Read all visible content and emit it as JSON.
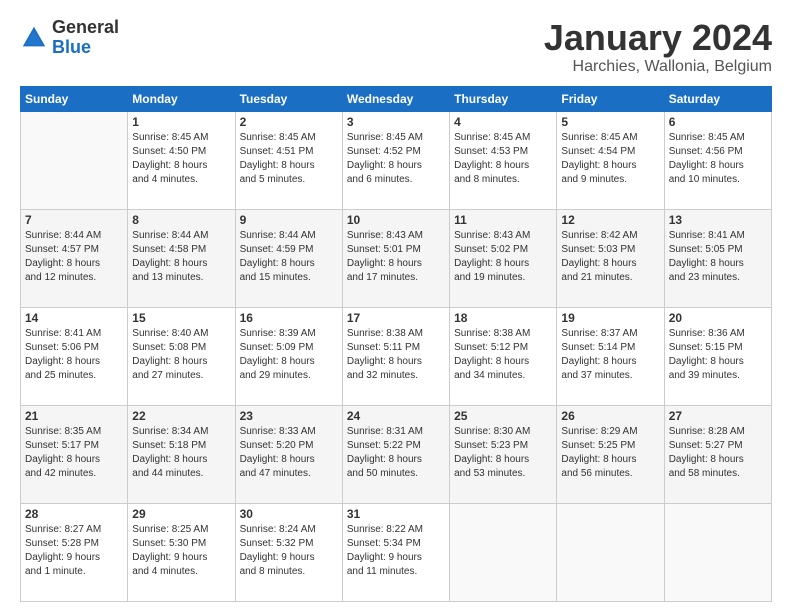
{
  "logo": {
    "general": "General",
    "blue": "Blue"
  },
  "title": "January 2024",
  "subtitle": "Harchies, Wallonia, Belgium",
  "weekdays": [
    "Sunday",
    "Monday",
    "Tuesday",
    "Wednesday",
    "Thursday",
    "Friday",
    "Saturday"
  ],
  "rows": [
    [
      {
        "day": "",
        "info": ""
      },
      {
        "day": "1",
        "info": "Sunrise: 8:45 AM\nSunset: 4:50 PM\nDaylight: 8 hours\nand 4 minutes."
      },
      {
        "day": "2",
        "info": "Sunrise: 8:45 AM\nSunset: 4:51 PM\nDaylight: 8 hours\nand 5 minutes."
      },
      {
        "day": "3",
        "info": "Sunrise: 8:45 AM\nSunset: 4:52 PM\nDaylight: 8 hours\nand 6 minutes."
      },
      {
        "day": "4",
        "info": "Sunrise: 8:45 AM\nSunset: 4:53 PM\nDaylight: 8 hours\nand 8 minutes."
      },
      {
        "day": "5",
        "info": "Sunrise: 8:45 AM\nSunset: 4:54 PM\nDaylight: 8 hours\nand 9 minutes."
      },
      {
        "day": "6",
        "info": "Sunrise: 8:45 AM\nSunset: 4:56 PM\nDaylight: 8 hours\nand 10 minutes."
      }
    ],
    [
      {
        "day": "7",
        "info": "Sunrise: 8:44 AM\nSunset: 4:57 PM\nDaylight: 8 hours\nand 12 minutes."
      },
      {
        "day": "8",
        "info": "Sunrise: 8:44 AM\nSunset: 4:58 PM\nDaylight: 8 hours\nand 13 minutes."
      },
      {
        "day": "9",
        "info": "Sunrise: 8:44 AM\nSunset: 4:59 PM\nDaylight: 8 hours\nand 15 minutes."
      },
      {
        "day": "10",
        "info": "Sunrise: 8:43 AM\nSunset: 5:01 PM\nDaylight: 8 hours\nand 17 minutes."
      },
      {
        "day": "11",
        "info": "Sunrise: 8:43 AM\nSunset: 5:02 PM\nDaylight: 8 hours\nand 19 minutes."
      },
      {
        "day": "12",
        "info": "Sunrise: 8:42 AM\nSunset: 5:03 PM\nDaylight: 8 hours\nand 21 minutes."
      },
      {
        "day": "13",
        "info": "Sunrise: 8:41 AM\nSunset: 5:05 PM\nDaylight: 8 hours\nand 23 minutes."
      }
    ],
    [
      {
        "day": "14",
        "info": "Sunrise: 8:41 AM\nSunset: 5:06 PM\nDaylight: 8 hours\nand 25 minutes."
      },
      {
        "day": "15",
        "info": "Sunrise: 8:40 AM\nSunset: 5:08 PM\nDaylight: 8 hours\nand 27 minutes."
      },
      {
        "day": "16",
        "info": "Sunrise: 8:39 AM\nSunset: 5:09 PM\nDaylight: 8 hours\nand 29 minutes."
      },
      {
        "day": "17",
        "info": "Sunrise: 8:38 AM\nSunset: 5:11 PM\nDaylight: 8 hours\nand 32 minutes."
      },
      {
        "day": "18",
        "info": "Sunrise: 8:38 AM\nSunset: 5:12 PM\nDaylight: 8 hours\nand 34 minutes."
      },
      {
        "day": "19",
        "info": "Sunrise: 8:37 AM\nSunset: 5:14 PM\nDaylight: 8 hours\nand 37 minutes."
      },
      {
        "day": "20",
        "info": "Sunrise: 8:36 AM\nSunset: 5:15 PM\nDaylight: 8 hours\nand 39 minutes."
      }
    ],
    [
      {
        "day": "21",
        "info": "Sunrise: 8:35 AM\nSunset: 5:17 PM\nDaylight: 8 hours\nand 42 minutes."
      },
      {
        "day": "22",
        "info": "Sunrise: 8:34 AM\nSunset: 5:18 PM\nDaylight: 8 hours\nand 44 minutes."
      },
      {
        "day": "23",
        "info": "Sunrise: 8:33 AM\nSunset: 5:20 PM\nDaylight: 8 hours\nand 47 minutes."
      },
      {
        "day": "24",
        "info": "Sunrise: 8:31 AM\nSunset: 5:22 PM\nDaylight: 8 hours\nand 50 minutes."
      },
      {
        "day": "25",
        "info": "Sunrise: 8:30 AM\nSunset: 5:23 PM\nDaylight: 8 hours\nand 53 minutes."
      },
      {
        "day": "26",
        "info": "Sunrise: 8:29 AM\nSunset: 5:25 PM\nDaylight: 8 hours\nand 56 minutes."
      },
      {
        "day": "27",
        "info": "Sunrise: 8:28 AM\nSunset: 5:27 PM\nDaylight: 8 hours\nand 58 minutes."
      }
    ],
    [
      {
        "day": "28",
        "info": "Sunrise: 8:27 AM\nSunset: 5:28 PM\nDaylight: 9 hours\nand 1 minute."
      },
      {
        "day": "29",
        "info": "Sunrise: 8:25 AM\nSunset: 5:30 PM\nDaylight: 9 hours\nand 4 minutes."
      },
      {
        "day": "30",
        "info": "Sunrise: 8:24 AM\nSunset: 5:32 PM\nDaylight: 9 hours\nand 8 minutes."
      },
      {
        "day": "31",
        "info": "Sunrise: 8:22 AM\nSunset: 5:34 PM\nDaylight: 9 hours\nand 11 minutes."
      },
      {
        "day": "",
        "info": ""
      },
      {
        "day": "",
        "info": ""
      },
      {
        "day": "",
        "info": ""
      }
    ]
  ]
}
